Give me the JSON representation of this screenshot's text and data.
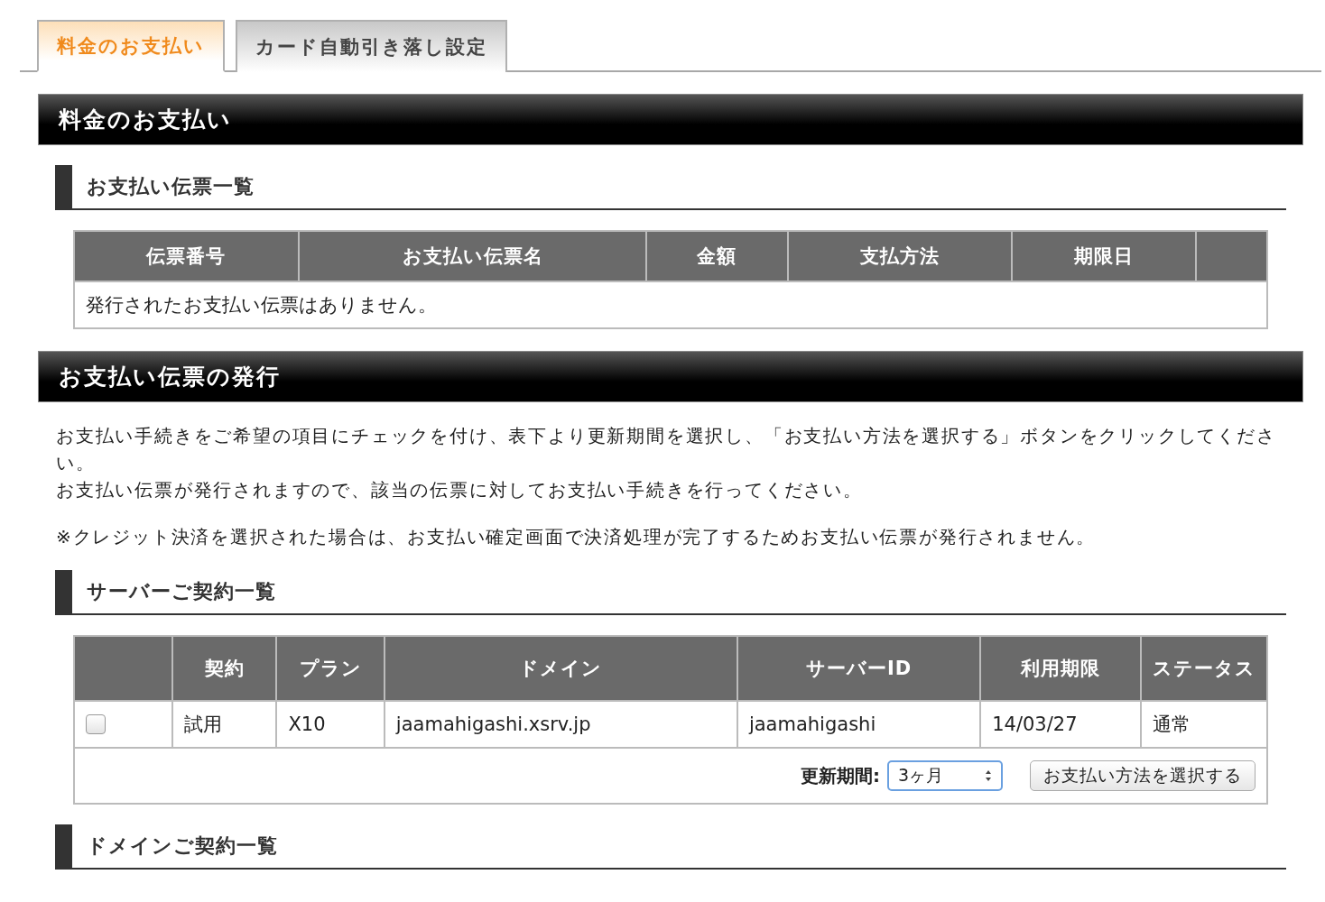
{
  "tabs": [
    {
      "label": "料金のお支払い",
      "selected": true
    },
    {
      "label": "カード自動引き落し設定",
      "selected": false
    }
  ],
  "payment_section": {
    "title": "料金のお支払い",
    "subheading": "お支払い伝票一覧",
    "table": {
      "columns": [
        "伝票番号",
        "お支払い伝票名",
        "金額",
        "支払方法",
        "期限日",
        ""
      ],
      "empty_message": "発行されたお支払い伝票はありません。"
    }
  },
  "issue_section": {
    "title": "お支払い伝票の発行",
    "paragraphs": [
      "お支払い手続きをご希望の項目にチェックを付け、表下より更新期間を選択し、「お支払い方法を選択する」ボタンをクリックしてください。",
      "お支払い伝票が発行されますので、該当の伝票に対してお支払い手続きを行ってください。",
      "※クレジット決済を選択された場合は、お支払い確定画面で決済処理が完了するためお支払い伝票が発行されません。"
    ],
    "subheading": "サーバーご契約一覧",
    "table": {
      "columns": [
        "",
        "契約",
        "プラン",
        "ドメイン",
        "サーバーID",
        "利用期限",
        "ステータス"
      ],
      "rows": [
        {
          "checked": false,
          "cells": [
            "",
            "試用",
            "X10",
            "jaamahigashi.xsrv.jp",
            "jaamahigashi",
            "14/03/27",
            "通常"
          ]
        }
      ],
      "footer": {
        "period_label": "更新期間:",
        "period_value": "3ヶ月",
        "button": "お支払い方法を選択する"
      }
    },
    "next_subheading": "ドメインご契約一覧"
  }
}
